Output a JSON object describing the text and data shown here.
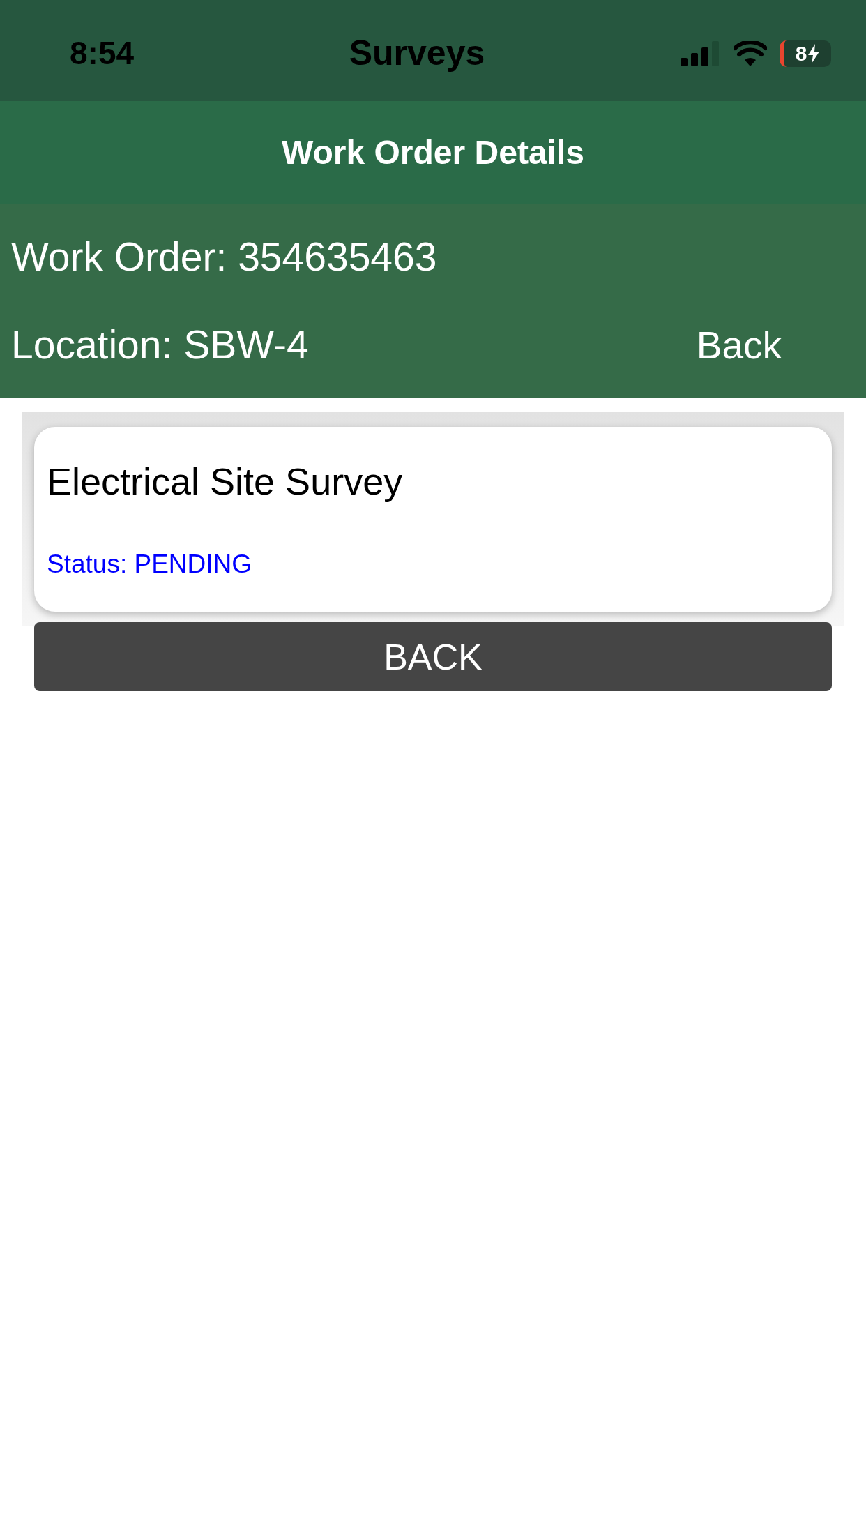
{
  "status_bar": {
    "time": "8:54",
    "app_title": "Surveys",
    "battery": "8",
    "charging": true
  },
  "header": {
    "title": "Work Order Details"
  },
  "info": {
    "work_order": "Work Order: 354635463",
    "location": "Location: SBW-4",
    "back_link": "Back"
  },
  "surveys": [
    {
      "title": "Electrical Site Survey",
      "status": "Status: PENDING"
    }
  ],
  "back_button": "BACK"
}
